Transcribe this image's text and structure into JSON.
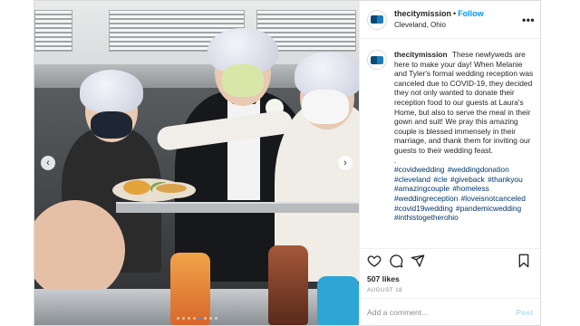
{
  "account": {
    "username": "thecitymission",
    "follow_label": "Follow",
    "separator": "•",
    "location": "Cleveland, Ohio",
    "more_label": "•••"
  },
  "caption": {
    "username": "thecitymission",
    "body": "These newlyweds are here to make your day! When Melanie and Tyler's formal wedding reception was canceled due to COVID-19, they decided they not only wanted to donate their reception food to our guests at Laura's Home, but also to serve the meal in their gown and suit! We pray this amazing couple is blessed immensely in their marriage, and thank them for inviting our guests to their wedding feast.",
    "dot_line": ".",
    "hashtags": "#covidwedding #weddingdonation #cleveland #cle #giveback #thankyou #amazingcouple #homeless #weddingreception #loveisnotcanceled #covid19wedding #pandemicwedding #inthistogetherohio"
  },
  "photo": {
    "prev_label": "‹",
    "next_label": "›",
    "slide_count": 8,
    "active_slide": 4
  },
  "icons": {
    "like": "heart-icon",
    "comment": "comment-icon",
    "share": "share-icon",
    "save": "bookmark-icon"
  },
  "stats": {
    "likes": "507 likes",
    "date": "AUGUST 18"
  },
  "comment_box": {
    "placeholder": "Add a comment...",
    "post_label": "Post"
  },
  "colors": {
    "follow": "#0095f6",
    "hashtag": "#00376b",
    "post_disabled": "#b2dffc",
    "active_dot": "#3897f0"
  }
}
